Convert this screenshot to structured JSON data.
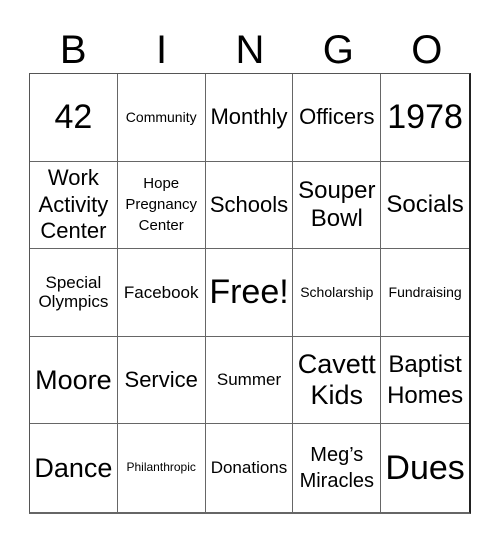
{
  "header": {
    "letters": [
      "B",
      "I",
      "N",
      "G",
      "O"
    ]
  },
  "cells": [
    {
      "text": "42"
    },
    {
      "text": "Community"
    },
    {
      "text": "Monthly"
    },
    {
      "text": "Officers"
    },
    {
      "text": "1978"
    },
    {
      "text": "Work Activity Center"
    },
    {
      "text": "Hope Pregnancy Center"
    },
    {
      "text": "Schools"
    },
    {
      "text": "Souper Bowl"
    },
    {
      "text": "Socials"
    },
    {
      "text": "Special Olympics"
    },
    {
      "text": "Facebook"
    },
    {
      "text": "Free!"
    },
    {
      "text": "Scholarship"
    },
    {
      "text": "Fundraising"
    },
    {
      "text": "Moore"
    },
    {
      "text": "Service"
    },
    {
      "text": "Summer"
    },
    {
      "text": "Cavett Kids"
    },
    {
      "text": "Baptist Homes"
    },
    {
      "text": "Dance"
    },
    {
      "text": "Philanthropic"
    },
    {
      "text": "Donations"
    },
    {
      "text": "Meg’s Miracles"
    },
    {
      "text": "Dues"
    }
  ]
}
